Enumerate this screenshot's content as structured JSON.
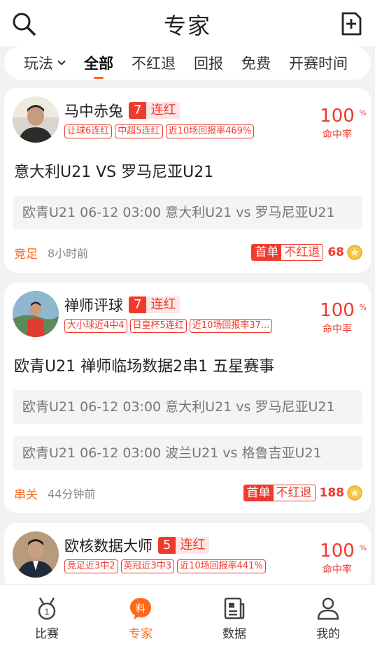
{
  "header": {
    "title": "专家",
    "search_icon": "search-icon",
    "add_icon": "add-note-icon"
  },
  "filters": {
    "play_label": "玩法",
    "tabs": [
      "全部",
      "不红退",
      "回报",
      "免费",
      "开赛时间"
    ],
    "active": "全部"
  },
  "cards": [
    {
      "name": "马中赤兔",
      "streak_num": "7",
      "streak_label": "连红",
      "tags": [
        "让球6连红",
        "中超5连红",
        "近10场回报率469%"
      ],
      "rate": "100",
      "rate_unit": "%",
      "rate_label": "命中率",
      "title": "意大利U21 VS 罗马尼亚U21",
      "matches": [
        "欧青U21  06-12 03:00  意大利U21 vs 罗马尼亚U21"
      ],
      "category": "竞足",
      "time": "8小时前",
      "badge_a": "首单",
      "badge_b": "不红退",
      "price": "68"
    },
    {
      "name": "禅师评球",
      "streak_num": "7",
      "streak_label": "连红",
      "tags": [
        "大小球近4中4",
        "日皇杯5连红",
        "近10场回报率37..."
      ],
      "rate": "100",
      "rate_unit": "%",
      "rate_label": "命中率",
      "title": "欧青U21 禅师临场数据2串1 五星赛事",
      "matches": [
        "欧青U21  06-12 03:00  意大利U21 vs 罗马尼亚U21",
        "欧青U21  06-12 03:00  波兰U21 vs 格鲁吉亚U21"
      ],
      "category": "串关",
      "time": "44分钟前",
      "badge_a": "首单",
      "badge_b": "不红退",
      "price": "188"
    },
    {
      "name": "欧核数据大师",
      "streak_num": "5",
      "streak_label": "连红",
      "tags": [
        "竞足近3中2",
        "英冠近3中3",
        "近10场回报率441%"
      ],
      "rate": "100",
      "rate_unit": "%",
      "rate_label": "命中率"
    }
  ],
  "tabbar": [
    {
      "label": "比赛",
      "icon": "medal-icon"
    },
    {
      "label": "专家",
      "icon": "tips-icon"
    },
    {
      "label": "数据",
      "icon": "news-icon"
    },
    {
      "label": "我的",
      "icon": "user-icon"
    }
  ],
  "colors": {
    "accent": "#ff6a1a",
    "red": "#f03a2e"
  }
}
